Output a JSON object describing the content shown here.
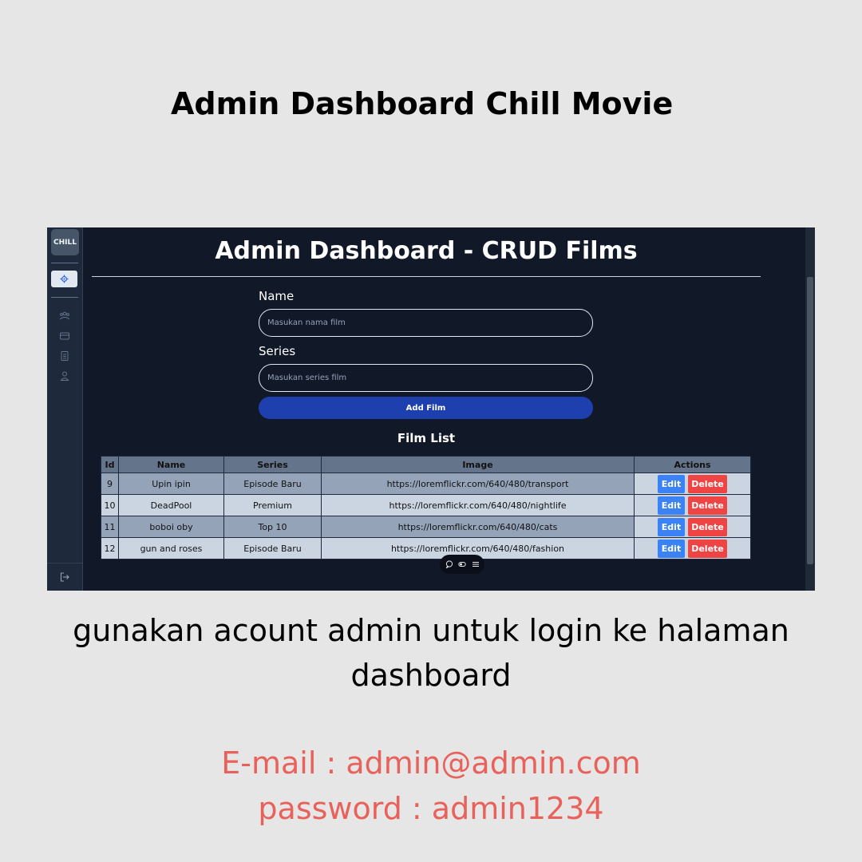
{
  "poster": {
    "title": "Admin Dashboard Chill Movie",
    "caption_line1": "gunakan acount admin untuk login ke halaman",
    "caption_line2": "dashboard",
    "email_line": "E-mail : admin@admin.com",
    "password_line": "password : admin1234"
  },
  "app": {
    "logo": "CHILL",
    "sidebar_icons": [
      "gear-icon",
      "users-icon",
      "card-icon",
      "document-icon",
      "user-icon",
      "logout-icon"
    ],
    "title": "Admin Dashboard - CRUD Films",
    "form": {
      "name_label": "Name",
      "name_placeholder": "Masukan nama film",
      "series_label": "Series",
      "series_placeholder": "Masukan series film",
      "submit_label": "Add Film"
    },
    "list_title": "Film List",
    "table": {
      "headers": [
        "Id",
        "Name",
        "Series",
        "Image",
        "Actions"
      ],
      "rows": [
        {
          "id": "9",
          "name": "Upin ipin",
          "series": "Episode Baru",
          "image": "https://loremflickr.com/640/480/transport"
        },
        {
          "id": "10",
          "name": "DeadPool",
          "series": "Premium",
          "image": "https://loremflickr.com/640/480/nightlife"
        },
        {
          "id": "11",
          "name": "boboi oby",
          "series": "Top 10",
          "image": "https://loremflickr.com/640/480/cats"
        },
        {
          "id": "12",
          "name": "gun and roses",
          "series": "Episode Baru",
          "image": "https://loremflickr.com/640/480/fashion"
        }
      ],
      "edit_label": "Edit",
      "delete_label": "Delete"
    }
  },
  "colors": {
    "background": "#e6e6e6",
    "app_bg": "#111827",
    "sidebar_bg": "#1e293b",
    "primary_button": "#1e40af",
    "edit_button": "#3b82f6",
    "delete_button": "#ef4444",
    "credentials_text": "#e8615a"
  }
}
